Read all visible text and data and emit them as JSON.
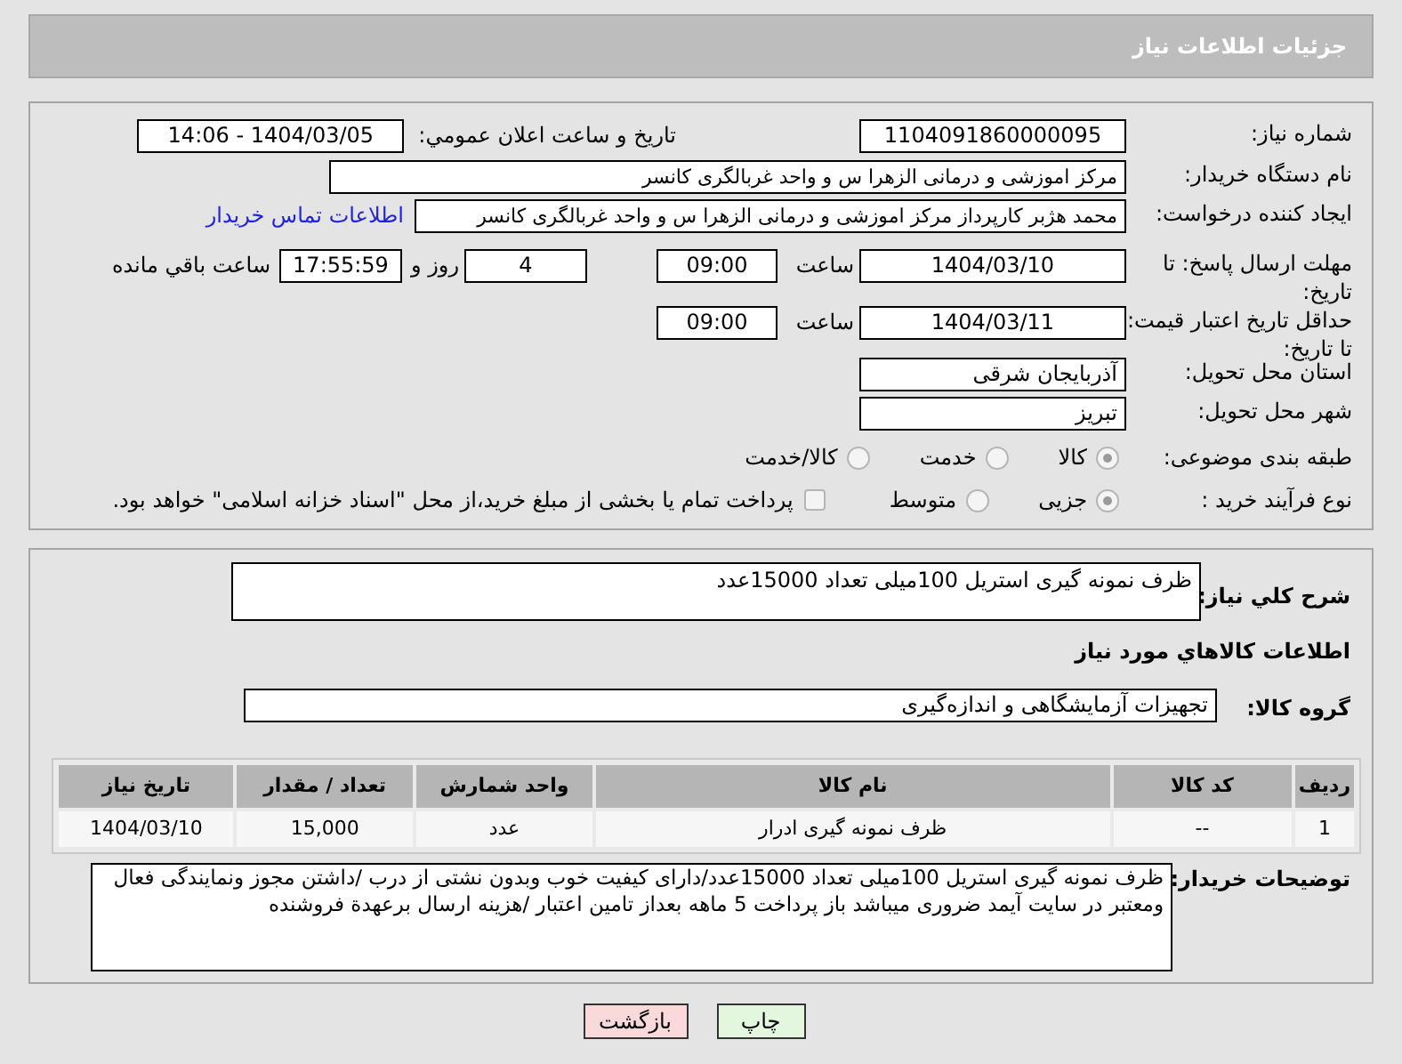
{
  "header": {
    "title": "جزئیات اطلاعات نیاز"
  },
  "need_number": {
    "label": "شماره نیاز:",
    "value": "1104091860000095"
  },
  "announcement": {
    "label": "تاریخ و ساعت اعلان عمومي:",
    "value": "1404/03/05 - 14:06"
  },
  "buyer_org": {
    "label": "نام دستگاه خریدار:",
    "value": "مرکز اموزشی و درمانی الزهرا س  و واحد غربالگری کانسر"
  },
  "requester": {
    "label": "ایجاد کننده درخواست:",
    "value": "محمد هژبر کارپرداز مرکز اموزشی و درمانی الزهرا س  و واحد غربالگری کانسر",
    "link": "اطلاعات تماس خریدار"
  },
  "response_deadline": {
    "label": "مهلت ارسال پاسخ: تا تاریخ:",
    "date": "1404/03/10",
    "time_label": "ساعت",
    "time": "09:00",
    "days": "4",
    "days_label": "روز و",
    "remaining": "17:55:59",
    "remaining_label": "ساعت باقي مانده"
  },
  "price_validity": {
    "label": "حداقل تاریخ اعتبار قیمت: تا تاریخ:",
    "date": "1404/03/11",
    "time_label": "ساعت",
    "time": "09:00"
  },
  "province": {
    "label": "استان محل تحویل:",
    "value": "آذربایجان شرقی"
  },
  "city": {
    "label": "شهر محل تحویل:",
    "value": "تبریز"
  },
  "category": {
    "label": "طبقه بندی موضوعی:",
    "options": [
      {
        "label": "کالا",
        "selected": true
      },
      {
        "label": "خدمت",
        "selected": false
      },
      {
        "label": "کالا/خدمت",
        "selected": false
      }
    ]
  },
  "purchase_process": {
    "label": "نوع فرآیند خرید :",
    "options": [
      {
        "label": "جزیی",
        "selected": true
      },
      {
        "label": "متوسط",
        "selected": false
      }
    ],
    "payment_note": {
      "checked": false,
      "text": "پرداخت تمام یا بخشی از مبلغ خرید،از محل \"اسناد خزانه اسلامی\" خواهد بود."
    }
  },
  "description": {
    "label": "شرح کلي نیاز:",
    "value": "ظرف نمونه گیری استریل 100میلی تعداد 15000عدد"
  },
  "goods_section_title": "اطلاعات كالاهاي مورد نیاز",
  "goods_group": {
    "label": "گروه کالا:",
    "value": "تجهیزات آزمایشگاهی و اندازه‌گیری"
  },
  "table": {
    "columns": [
      "ردیف",
      "کد کالا",
      "نام کالا",
      "واحد شمارش",
      "تعداد / مقدار",
      "تاریخ نیاز"
    ],
    "rows": [
      [
        "1",
        "--",
        "ظرف نمونه گیری ادرار",
        "عدد",
        "15,000",
        "1404/03/10"
      ]
    ]
  },
  "buyer_notes": {
    "label": "توضیحات خریدار:",
    "value": "ظرف نمونه گیری استریل 100میلی تعداد 15000عدد/دارای کیفیت خوب وبدون نشتی از درب /داشتن مجوز ونمایندگی فعال ومعتبر در سایت آیمد ضروری میباشد باز پرداخت 5 ماهه بعداز تامین اعتبار /هزینه ارسال برعهدة فروشنده"
  },
  "buttons": [
    {
      "kind": "print",
      "label": "چاپ"
    },
    {
      "kind": "back",
      "label": "بازگشت"
    }
  ]
}
